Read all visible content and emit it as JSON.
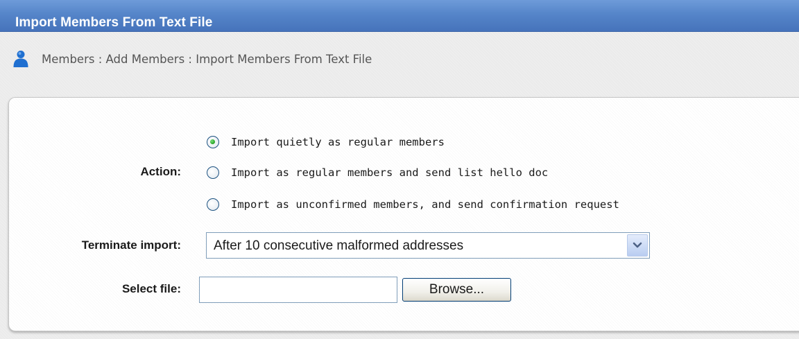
{
  "window": {
    "title": "Import Members From Text File"
  },
  "breadcrumb": {
    "icon": "user-icon",
    "text": "Members : Add Members : Import Members From Text File"
  },
  "form": {
    "action": {
      "label": "Action:",
      "options": [
        {
          "label": "Import quietly as regular members",
          "checked": true
        },
        {
          "label": "Import as regular members and send list hello doc",
          "checked": false
        },
        {
          "label": "Import as unconfirmed members, and send confirmation request",
          "checked": false
        }
      ]
    },
    "terminate": {
      "label": "Terminate import:",
      "selected": "After 10 consecutive malformed addresses"
    },
    "file": {
      "label": "Select file:",
      "value": "",
      "browse_label": "Browse..."
    }
  },
  "colors": {
    "title_bar": "#5585c9",
    "radio_checked": "#2eaa2e",
    "input_border": "#7f9db9"
  }
}
